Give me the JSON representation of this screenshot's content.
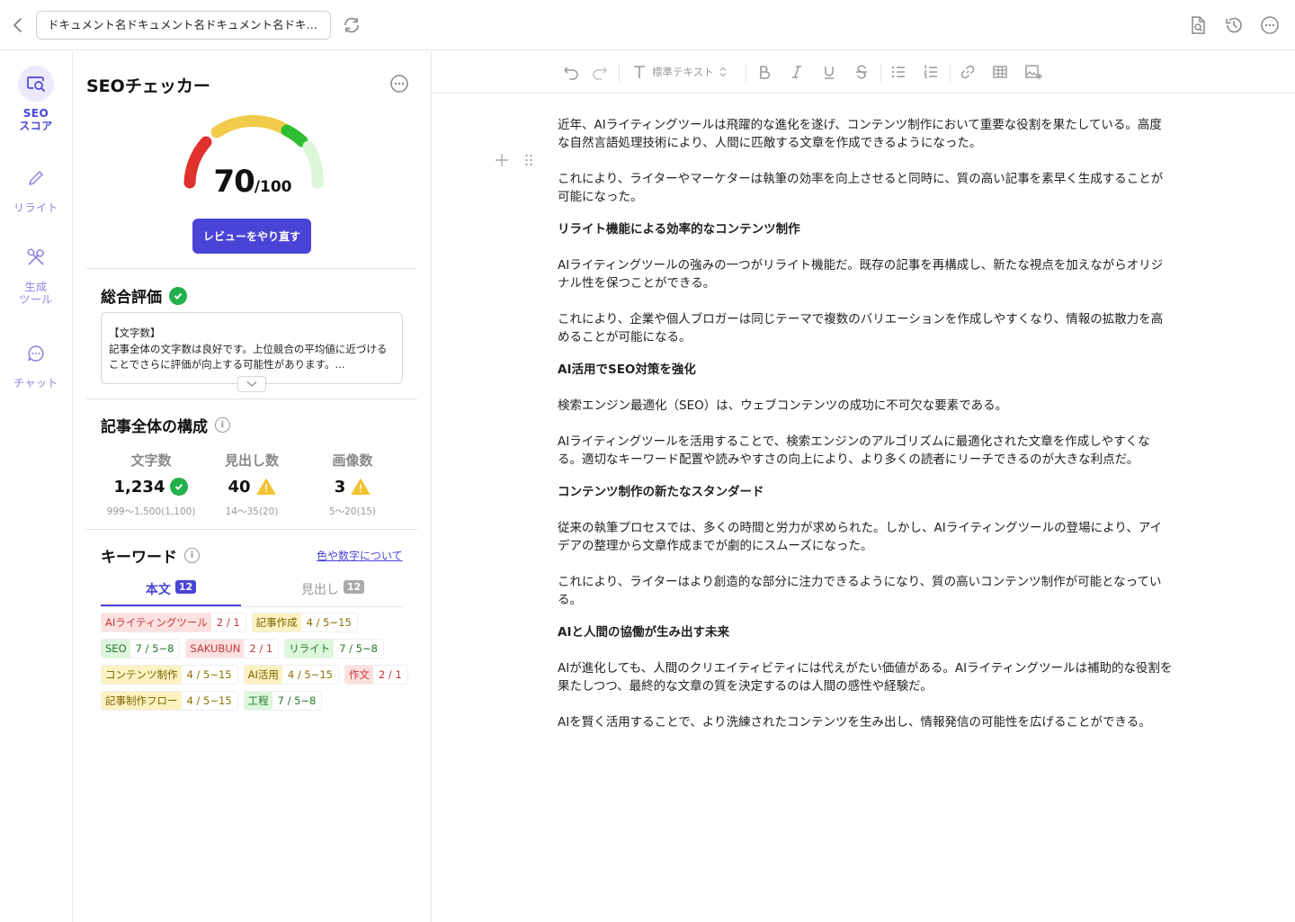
{
  "topbar": {
    "doc_title": "ドキュメント名ドキュメント名ドキュメント名ドキュ...",
    "icons": [
      "back-icon",
      "refresh-icon",
      "preview-icon",
      "history-icon",
      "more-icon"
    ]
  },
  "rail": {
    "items": [
      {
        "label": "SEO\nスコア",
        "icon": "seo-score-icon",
        "active": true
      },
      {
        "label": "リライト",
        "icon": "pencil-icon",
        "active": false
      },
      {
        "label": "生成\nツール",
        "icon": "tools-icon",
        "active": false
      },
      {
        "label": "チャット",
        "icon": "chat-icon",
        "active": false
      }
    ]
  },
  "seo": {
    "title": "SEOチェッカー",
    "score": {
      "value": "70",
      "max": "/100",
      "fraction": 0.7
    },
    "review_button": "レビューをやり直す",
    "overall": {
      "title": "総合評価",
      "status": "ok",
      "text_heading": "【文字数】",
      "text_body": "記事全体の文字数は良好です。上位競合の平均値に近づけることでさらに評価が向上する可能性があります。..."
    },
    "structure": {
      "title": "記事全体の構成",
      "stats": [
        {
          "label": "文字数",
          "value": "1,234",
          "status": "ok",
          "range": "999〜1,500(1,100)"
        },
        {
          "label": "見出し数",
          "value": "40",
          "status": "warn",
          "range": "14〜35(20)"
        },
        {
          "label": "画像数",
          "value": "3",
          "status": "warn",
          "range": "5〜20(15)"
        }
      ]
    },
    "keywords": {
      "title": "キーワード",
      "link": "色や数字について",
      "tabs": [
        {
          "label": "本文",
          "count": "12",
          "active": true
        },
        {
          "label": "見出し",
          "count": "12",
          "active": false
        }
      ],
      "rows": [
        [
          {
            "kw": "AIライティングツール",
            "n": "2 / 1",
            "color": "red"
          },
          {
            "kw": "記事作成",
            "n": "4 / 5~15",
            "color": "yellow"
          }
        ],
        [
          {
            "kw": "SEO",
            "n": "7 / 5~8",
            "color": "green"
          },
          {
            "kw": "SAKUBUN",
            "n": "2 / 1",
            "color": "red"
          },
          {
            "kw": "リライト",
            "n": "7 / 5~8",
            "color": "green"
          }
        ],
        [
          {
            "kw": "コンテンツ制作",
            "n": "4 / 5~15",
            "color": "yellow"
          },
          {
            "kw": "AI活用",
            "n": "4 / 5~15",
            "color": "yellow"
          },
          {
            "kw": "作文",
            "n": "2 / 1",
            "color": "red"
          }
        ],
        [
          {
            "kw": "記事制作フロー",
            "n": "4 / 5~15",
            "color": "yellow"
          },
          {
            "kw": "工程",
            "n": "7 / 5~8",
            "color": "green"
          }
        ]
      ]
    }
  },
  "toolbar": {
    "text_style": "標準テキスト",
    "icons": [
      "undo-icon",
      "redo-icon",
      "text-style-icon",
      "bold-icon",
      "italic-icon",
      "underline-icon",
      "strikethrough-icon",
      "bullet-list-icon",
      "numbered-list-icon",
      "link-icon",
      "table-icon",
      "image-add-icon"
    ]
  },
  "editor": {
    "blocks": [
      {
        "type": "p",
        "text": "近年、AIライティングツールは飛躍的な進化を遂げ、コンテンツ制作において重要な役割を果たしている。高度な自然言語処理技術により、人間に匹敵する文章を作成できるようになった。"
      },
      {
        "type": "p",
        "text": "これにより、ライターやマーケターは執筆の効率を向上させると同時に、質の高い記事を素早く生成することが可能になった。"
      },
      {
        "type": "h",
        "text": "リライト機能による効率的なコンテンツ制作"
      },
      {
        "type": "p",
        "text": "AIライティングツールの強みの一つがリライト機能だ。既存の記事を再構成し、新たな視点を加えながらオリジナル性を保つことができる。"
      },
      {
        "type": "p",
        "text": "これにより、企業や個人ブロガーは同じテーマで複数のバリエーションを作成しやすくなり、情報の拡散力を高めることが可能になる。"
      },
      {
        "type": "h",
        "text": "AI活用でSEO対策を強化"
      },
      {
        "type": "p",
        "text": "検索エンジン最適化（SEO）は、ウェブコンテンツの成功に不可欠な要素である。"
      },
      {
        "type": "p",
        "text": "AIライティングツールを活用することで、検索エンジンのアルゴリズムに最適化された文章を作成しやすくなる。適切なキーワード配置や読みやすさの向上により、より多くの読者にリーチできるのが大きな利点だ。"
      },
      {
        "type": "h",
        "text": "コンテンツ制作の新たなスタンダード"
      },
      {
        "type": "p",
        "text": "従来の執筆プロセスでは、多くの時間と労力が求められた。しかし、AIライティングツールの登場により、アイデアの整理から文章作成までが劇的にスムーズになった。"
      },
      {
        "type": "p",
        "text": "これにより、ライターはより創造的な部分に注力できるようになり、質の高いコンテンツ制作が可能となっている。"
      },
      {
        "type": "h",
        "text": "AIと人間の協働が生み出す未来"
      },
      {
        "type": "p",
        "text": "AIが進化しても、人間のクリエイティビティには代えがたい価値がある。AIライティングツールは補助的な役割を果たしつつ、最終的な文章の質を決定するのは人間の感性や経験だ。"
      },
      {
        "type": "p",
        "text": "AIを賢く活用することで、より洗練されたコンテンツを生み出し、情報発信の可能性を広げることができる。"
      }
    ]
  }
}
